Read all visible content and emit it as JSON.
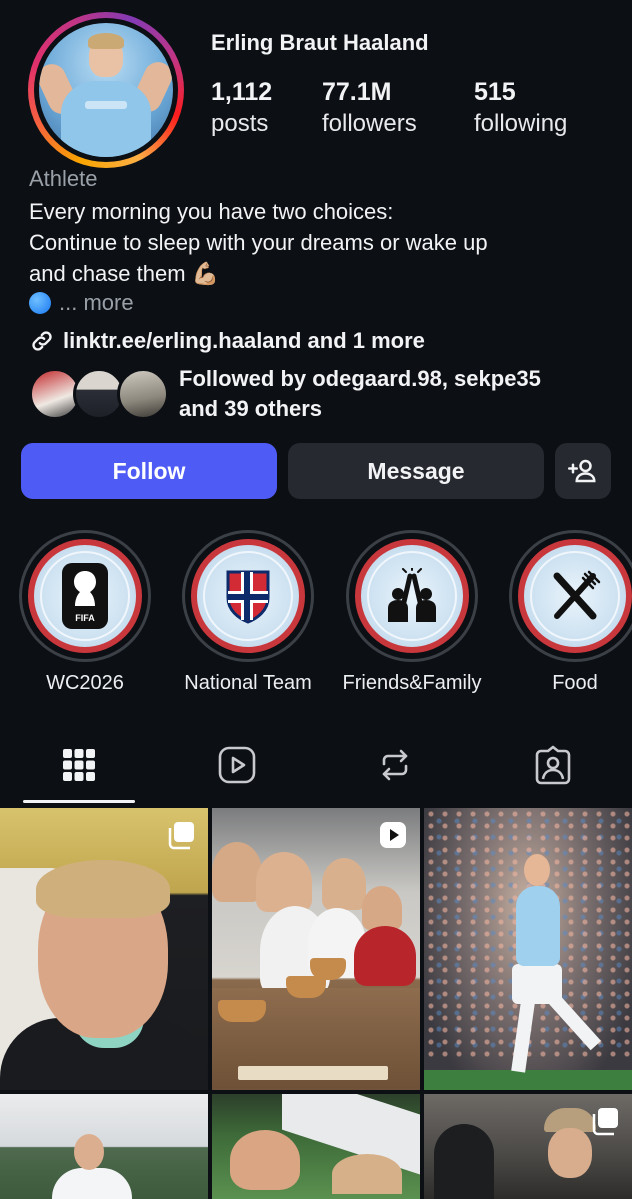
{
  "profile": {
    "name": "Erling Braut Haaland",
    "stats": [
      {
        "value": "1,112",
        "label": "posts"
      },
      {
        "value": "77.1M",
        "label": "followers"
      },
      {
        "value": "515",
        "label": "following"
      }
    ],
    "category": "Athlete",
    "bio_lines": [
      "Every morning you have two choices:",
      "Continue to sleep with your dreams or wake up",
      "and chase them 💪🏼"
    ],
    "more_label": "... more",
    "link_text": "linktr.ee/erling.haaland and 1 more",
    "followed_by_line1": "Followed by odegaard.98, sekpe35",
    "followed_by_line2": "and 39 others"
  },
  "buttons": {
    "follow": "Follow",
    "message": "Message",
    "add_user_icon": "add-user-icon"
  },
  "highlights": [
    {
      "label": "WC2026",
      "icon": "fifa-trophy-icon"
    },
    {
      "label": "National Team",
      "icon": "norway-crest-icon"
    },
    {
      "label": "Friends&Family",
      "icon": "high-five-icon"
    },
    {
      "label": "Food",
      "icon": "fork-knife-icon"
    }
  ],
  "tabs": [
    {
      "icon": "grid-icon",
      "active": true
    },
    {
      "icon": "reels-icon",
      "active": false
    },
    {
      "icon": "reposts-icon",
      "active": false
    },
    {
      "icon": "tagged-icon",
      "active": false
    }
  ],
  "posts": [
    {
      "type": "carousel",
      "icon": "carousel-icon"
    },
    {
      "type": "reel",
      "icon": "reel-icon"
    },
    {
      "type": "photo",
      "icon": ""
    },
    {
      "type": "photo",
      "icon": ""
    },
    {
      "type": "photo",
      "icon": ""
    },
    {
      "type": "carousel",
      "icon": "carousel-icon"
    }
  ],
  "colors": {
    "background": "#0c0f14",
    "follow_button": "#4f5bf5",
    "secondary_button": "#26292f",
    "muted_text": "#9aa0a8"
  }
}
